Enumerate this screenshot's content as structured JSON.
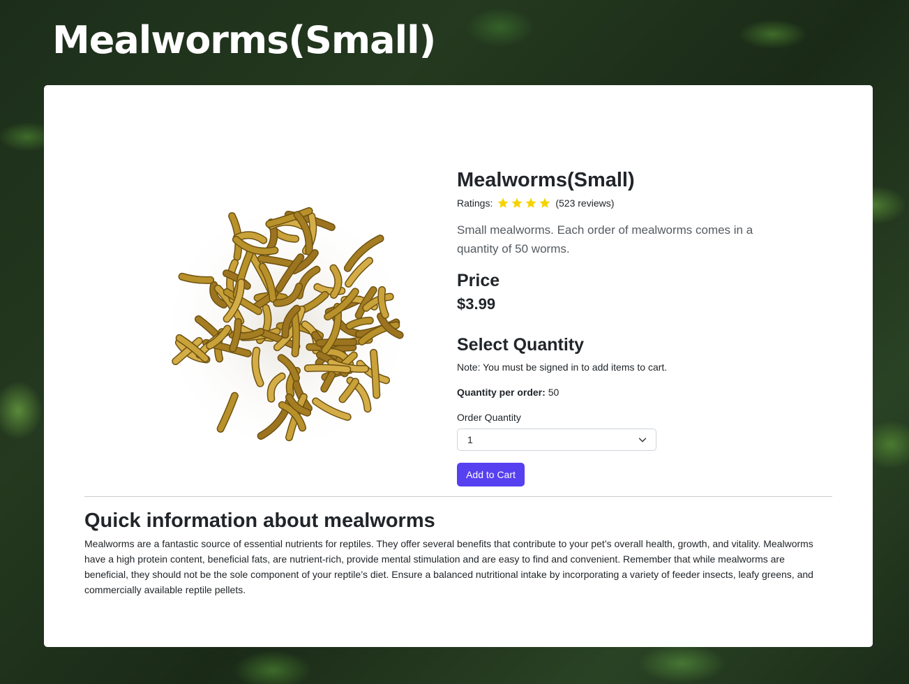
{
  "header": {
    "title": "Mealworms(Small)"
  },
  "product": {
    "name": "Mealworms(Small)",
    "ratings_label": "Ratings:",
    "stars": 4,
    "reviews": "(523 reviews)",
    "description": "Small mealworms. Each order of mealworms comes in a quantity of 50 worms.",
    "image_alt": "mealworms-photo"
  },
  "price": {
    "heading": "Price",
    "value": "$3.99"
  },
  "quantity": {
    "heading": "Select Quantity",
    "note": "Note: You must be signed in to add items to cart.",
    "per_order_label": "Quantity per order:",
    "per_order_value": "50",
    "order_label": "Order Quantity",
    "selected": "1",
    "button": "Add to Cart"
  },
  "info": {
    "heading": "Quick information about mealworms",
    "text": "Mealworms are a fantastic source of essential nutrients for reptiles. They offer several benefits that contribute to your pet’s overall health, growth, and vitality. Mealworms have a high protein content, beneficial fats, are nutrient-rich, provide mental stimulation and are easy to find and convenient. Remember that while mealworms are beneficial, they should not be the sole component of your reptile’s diet. Ensure a balanced nutritional intake by incorporating a variety of feeder insects, leafy greens, and commercially available reptile pellets."
  },
  "colors": {
    "accent": "#5640f0",
    "star": "#f5d300",
    "worm": "#c19a2e"
  }
}
